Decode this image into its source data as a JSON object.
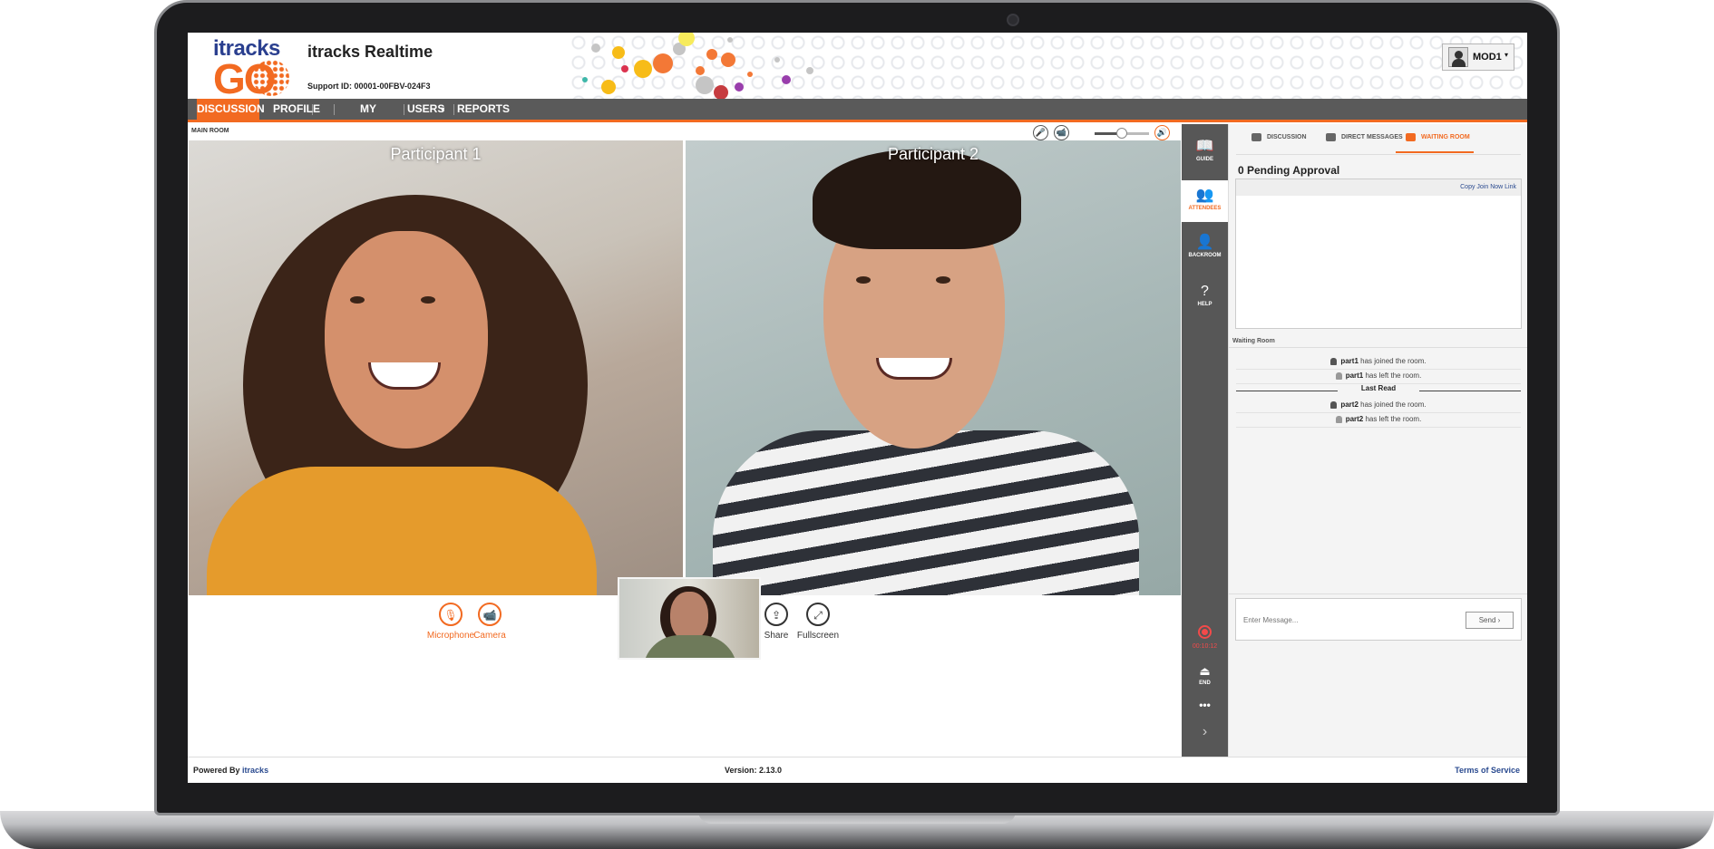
{
  "header": {
    "logo_top": "itracks",
    "logo_bottom": "GO",
    "title": "itracks Realtime",
    "support_id": "Support ID: 00001-00FBV-024F3",
    "user": {
      "name": "MOD1",
      "caret": "▾"
    }
  },
  "nav": {
    "items": [
      {
        "label": "DISCUSSION",
        "active": true
      },
      {
        "label": "PROFILE LIST",
        "active": false
      },
      {
        "label": "MY PROFILE",
        "active": false
      },
      {
        "label": "USERS",
        "caret": "▾",
        "active": false
      },
      {
        "label": "REPORTS",
        "active": false
      }
    ]
  },
  "main_room": {
    "label": "MAIN ROOM",
    "controls": {
      "mute_icon": "🎤",
      "camera_icon": "📹",
      "speaker_icon": "🔊",
      "volume": 0.5
    }
  },
  "video": {
    "participants": [
      {
        "name": "Participant 1"
      },
      {
        "name": "Participant 2"
      }
    ]
  },
  "media_controls": {
    "microphone": {
      "label": "Microphone",
      "icon": "🎙"
    },
    "camera": {
      "label": "Camera",
      "icon": "📹"
    },
    "share": {
      "label": "Share",
      "icon": "⇪"
    },
    "fullscreen": {
      "label": "Fullscreen",
      "icon": "⤢"
    }
  },
  "tools": {
    "guide": {
      "label": "GUIDE",
      "icon": "📖"
    },
    "attendees": {
      "label": "ATTENDEES",
      "icon": "👥"
    },
    "backroom": {
      "label": "BACKROOM",
      "icon": "👤"
    },
    "help": {
      "label": "HELP",
      "icon": "?"
    },
    "recording_time": "00:10:12",
    "end": {
      "label": "END",
      "icon": "⏏"
    },
    "more_icon": "•••",
    "expand_icon": "›"
  },
  "right_panel": {
    "tabs": [
      {
        "label": "DISCUSSION",
        "active": false
      },
      {
        "label": "DIRECT MESSAGES",
        "active": false
      },
      {
        "label": "WAITING ROOM",
        "active": true
      }
    ],
    "pending_title": "0 Pending Approval",
    "copy_link": "Copy Join Now Link",
    "waiting_label": "Waiting Room",
    "events": [
      {
        "user": "part1",
        "text": "has joined the room.",
        "type": "joined"
      },
      {
        "user": "part1",
        "text": "has left the room.",
        "type": "left"
      },
      {
        "user": "part2",
        "text": "has joined the room.",
        "type": "joined"
      },
      {
        "user": "part2",
        "text": "has left the room.",
        "type": "left"
      }
    ],
    "last_read": "Last Read",
    "message_placeholder": "Enter Message...",
    "send_label": "Send ›"
  },
  "footer": {
    "powered_prefix": "Powered By",
    "powered_brand": "itracks",
    "version": "Version: 2.13.0",
    "terms": "Terms of Service"
  }
}
